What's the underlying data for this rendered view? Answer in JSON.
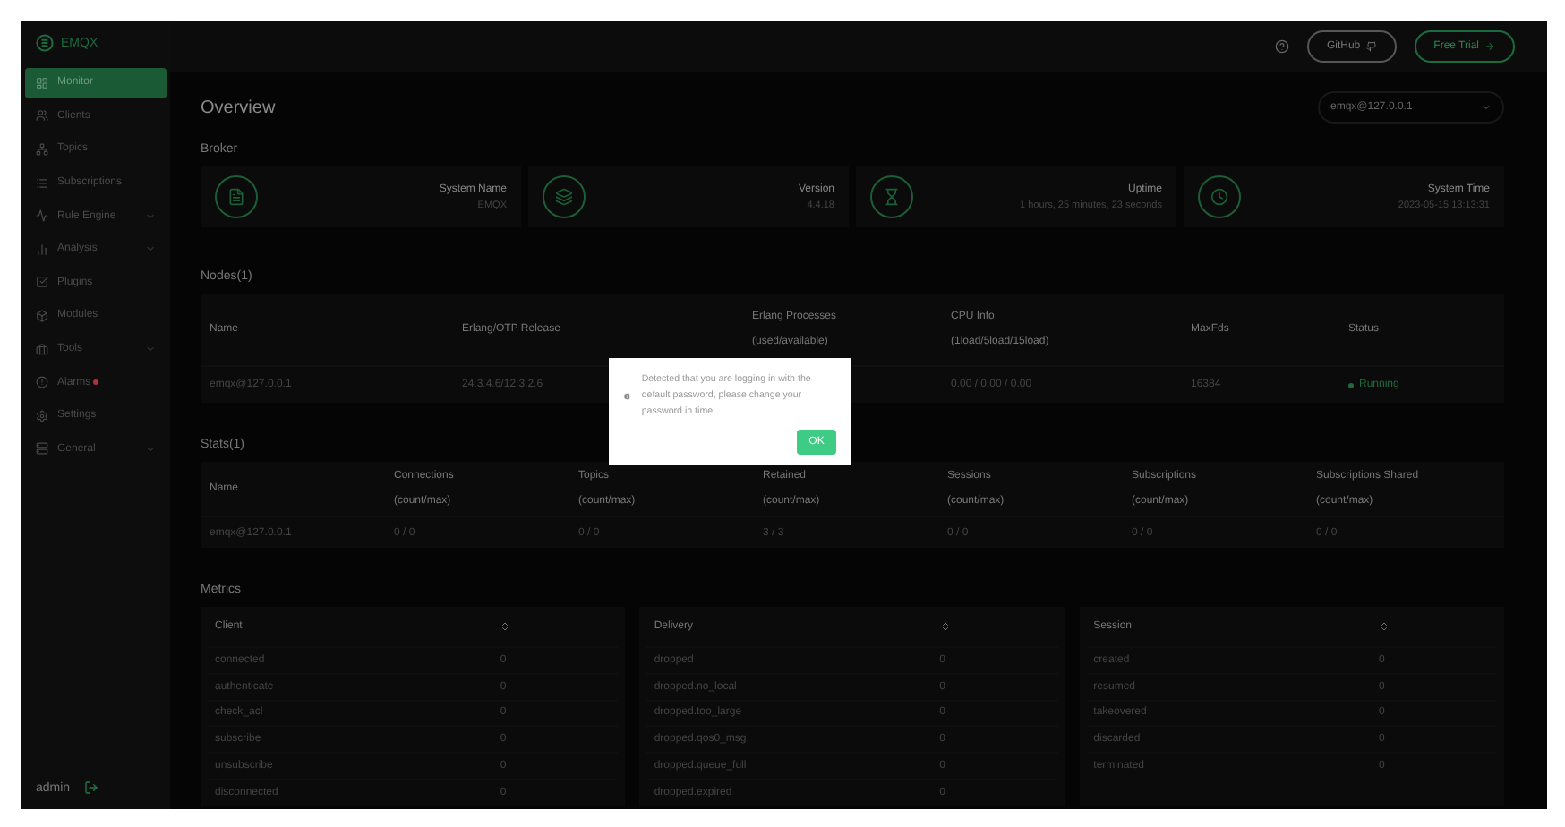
{
  "sidebar": {
    "logo": "EMQX",
    "items": [
      {
        "label": "Monitor",
        "selected": true,
        "expandable": false,
        "alert": false
      },
      {
        "label": "Clients",
        "selected": false,
        "expandable": false,
        "alert": false
      },
      {
        "label": "Topics",
        "selected": false,
        "expandable": false,
        "alert": false
      },
      {
        "label": "Subscriptions",
        "selected": false,
        "expandable": false,
        "alert": false
      },
      {
        "label": "Rule Engine",
        "selected": false,
        "expandable": true,
        "alert": false
      },
      {
        "label": "Analysis",
        "selected": false,
        "expandable": true,
        "alert": false
      },
      {
        "label": "Plugins",
        "selected": false,
        "expandable": false,
        "alert": false
      },
      {
        "label": "Modules",
        "selected": false,
        "expandable": false,
        "alert": false
      },
      {
        "label": "Tools",
        "selected": false,
        "expandable": true,
        "alert": false
      },
      {
        "label": "Alarms",
        "selected": false,
        "expandable": false,
        "alert": true
      },
      {
        "label": "Settings",
        "selected": false,
        "expandable": false,
        "alert": false
      },
      {
        "label": "General",
        "selected": false,
        "expandable": true,
        "alert": false
      }
    ],
    "user": "admin"
  },
  "header": {
    "github": "GitHub",
    "trial": "Free Trial"
  },
  "overview": {
    "title": "Overview",
    "node_select": "emqx@127.0.0.1"
  },
  "broker": {
    "title": "Broker",
    "cards": [
      {
        "label": "System Name",
        "value": "EMQX"
      },
      {
        "label": "Version",
        "value": "4.4.18"
      },
      {
        "label": "Uptime",
        "value": "1 hours, 25 minutes, 23 seconds"
      },
      {
        "label": "System Time",
        "value": "2023-05-15 13:13:31"
      }
    ]
  },
  "nodes": {
    "title": "Nodes(1)",
    "columns": [
      {
        "label": "Name",
        "kind": "text"
      },
      {
        "label": "Erlang/OTP Release",
        "kind": "text"
      },
      {
        "label": "Erlang Processes",
        "sublabel": "(used/available)",
        "kind": "text"
      },
      {
        "label": "CPU Info",
        "sublabel": "(1load/5load/15load)",
        "kind": "text"
      },
      {
        "label": "MaxFds",
        "kind": "text"
      },
      {
        "label": "Status",
        "kind": "status"
      }
    ],
    "rows": [
      [
        "emqx@127.0.0.1",
        "24.3.4.6/12.3.2.6",
        "",
        "0.00 / 0.00 / 0.00",
        "16384",
        "Running"
      ]
    ]
  },
  "stats": {
    "title": "Stats(1)",
    "columns": [
      {
        "label": "Name",
        "kind": "text"
      },
      {
        "label": "Connections",
        "sublabel": "(count/max)",
        "kind": "text"
      },
      {
        "label": "Topics",
        "sublabel": "(count/max)",
        "kind": "text"
      },
      {
        "label": "Retained",
        "sublabel": "(count/max)",
        "kind": "text"
      },
      {
        "label": "Sessions",
        "sublabel": "(count/max)",
        "kind": "text"
      },
      {
        "label": "Subscriptions",
        "sublabel": "(count/max)",
        "kind": "text"
      },
      {
        "label": "Subscriptions Shared",
        "sublabel": "(count/max)",
        "kind": "text"
      }
    ],
    "rows": [
      [
        "emqx@127.0.0.1",
        "0 / 0",
        "0 / 0",
        "3 / 3",
        "0 / 0",
        "0 / 0",
        "0 / 0"
      ]
    ]
  },
  "metrics": {
    "title": "Metrics",
    "panels": [
      {
        "title": "Client",
        "rows": [
          {
            "name": "connected",
            "value": "0"
          },
          {
            "name": "authenticate",
            "value": "0"
          },
          {
            "name": "check_acl",
            "value": "0"
          },
          {
            "name": "subscribe",
            "value": "0"
          },
          {
            "name": "unsubscribe",
            "value": "0"
          },
          {
            "name": "disconnected",
            "value": "0"
          }
        ]
      },
      {
        "title": "Delivery",
        "rows": [
          {
            "name": "dropped",
            "value": "0"
          },
          {
            "name": "dropped.no_local",
            "value": "0"
          },
          {
            "name": "dropped.too_large",
            "value": "0"
          },
          {
            "name": "dropped.qos0_msg",
            "value": "0"
          },
          {
            "name": "dropped.queue_full",
            "value": "0"
          },
          {
            "name": "dropped.expired",
            "value": "0"
          }
        ]
      },
      {
        "title": "Session",
        "rows": [
          {
            "name": "created",
            "value": "0"
          },
          {
            "name": "resumed",
            "value": "0"
          },
          {
            "name": "takeovered",
            "value": "0"
          },
          {
            "name": "discarded",
            "value": "0"
          },
          {
            "name": "terminated",
            "value": "0"
          }
        ]
      }
    ]
  },
  "dialog": {
    "message": "Detected that you are logging in with the default password, please change your password in time",
    "ok": "OK"
  }
}
